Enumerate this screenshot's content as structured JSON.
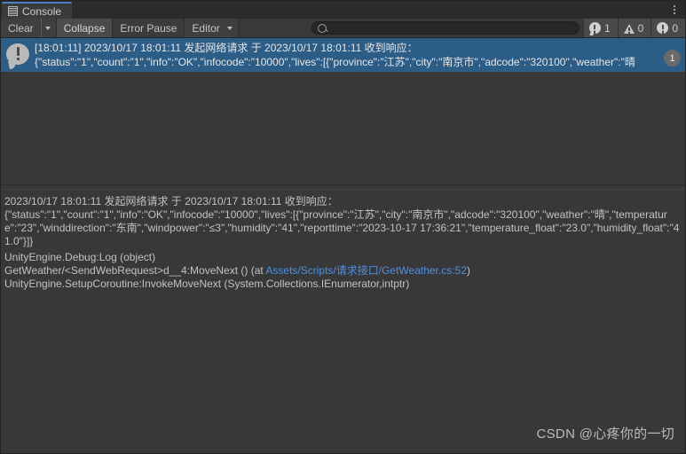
{
  "window": {
    "tab": {
      "label": "Console",
      "icon": "console-document-icon"
    },
    "menu_icon": "kebab-menu-icon"
  },
  "toolbar": {
    "clear_label": "Clear",
    "clear_dropdown_icon": "chevron-down-icon",
    "collapse_label": "Collapse",
    "error_pause_label": "Error Pause",
    "editor_label": "Editor",
    "editor_dropdown_icon": "chevron-down-icon",
    "search": {
      "value": "",
      "placeholder": "",
      "icon": "search-icon"
    },
    "counters": [
      {
        "name": "error-count",
        "icon": "error-icon",
        "value": "1"
      },
      {
        "name": "warning-count",
        "icon": "warning-icon",
        "value": "0"
      },
      {
        "name": "info-count",
        "icon": "info-icon",
        "value": "0"
      }
    ]
  },
  "log_list": {
    "rows": [
      {
        "icon": "log-error-bubble-icon",
        "line1": "[18:01:11] 2023/10/17 18:01:11 发起网络请求 于 2023/10/17 18:01:11 收到响应：",
        "line2": "{\"status\":\"1\",\"count\":\"1\",\"info\":\"OK\",\"infocode\":\"10000\",\"lives\":[{\"province\":\"江苏\",\"city\":\"南京市\",\"adcode\":\"320100\",\"weather\":\"晴",
        "collapse_count": "1",
        "selected": true
      }
    ]
  },
  "detail": {
    "message": "2023/10/17 18:01:11 发起网络请求 于 2023/10/17 18:01:11 收到响应：\n{\"status\":\"1\",\"count\":\"1\",\"info\":\"OK\",\"infocode\":\"10000\",\"lives\":[{\"province\":\"江苏\",\"city\":\"南京市\",\"adcode\":\"320100\",\"weather\":\"晴\",\"temperature\":\"23\",\"winddirection\":\"东南\",\"windpower\":\"≤3\",\"humidity\":\"41\",\"reporttime\":\"2023-10-17 17:36:21\",\"temperature_float\":\"23.0\",\"humidity_float\":\"41.0\"}]}",
    "stack": [
      {
        "text": "UnityEngine.Debug:Log (object)",
        "link": ""
      },
      {
        "prefix": "GetWeather/<SendWebRequest>d__4:MoveNext () (at ",
        "link": "Assets/Scripts/请求接口/GetWeather.cs:52",
        "suffix": ")"
      },
      {
        "text": "UnityEngine.SetupCoroutine:InvokeMoveNext (System.Collections.IEnumerator,intptr)",
        "link": ""
      }
    ]
  },
  "watermark": {
    "text": "CSDN @心疼你的一切"
  },
  "colors": {
    "selection": "#2c5d87",
    "window_bg": "#383838",
    "toolbar_bg": "#393939",
    "link": "#4f8fe0",
    "tab_accent": "#4a80c0"
  }
}
